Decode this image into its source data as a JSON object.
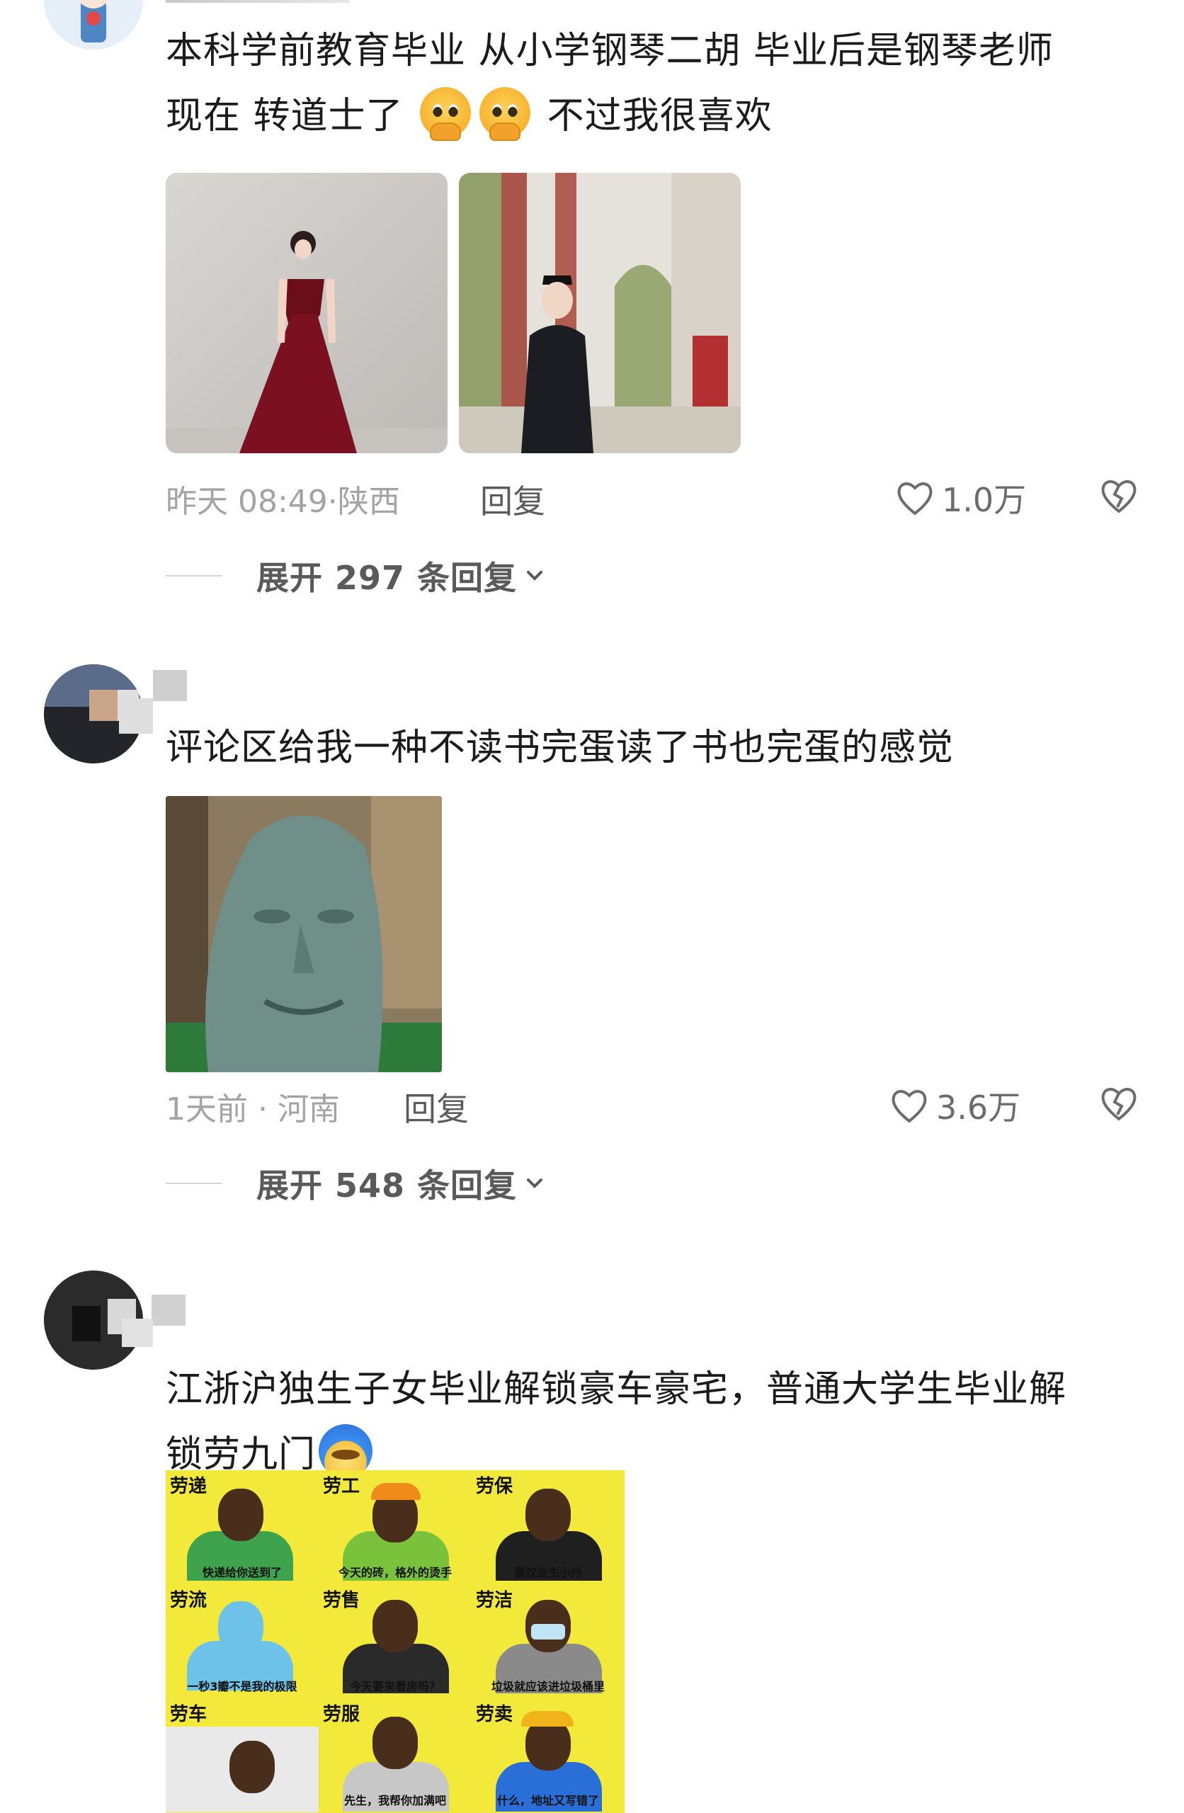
{
  "comments": [
    {
      "text_line1": "本科学前教育毕业 从小学钢琴二胡 毕业后是钢琴老师",
      "text_line2_prefix": "现在 转道士了",
      "text_line2_emoji": [
        "pleading-face-emoji",
        "pleading-face-emoji"
      ],
      "text_line2_suffix": "不过我很喜欢",
      "images": [
        "red-gown-photo",
        "taoist-robe-photo"
      ],
      "time": "昨天 08:49",
      "location": "陕西",
      "reply": "回复",
      "likes": "1.0万",
      "expand": "展开 297 条回复"
    },
    {
      "text_line1": "评论区给我一种不读书完蛋读了书也完蛋的感觉",
      "images": [
        "fish-face-meme"
      ],
      "time": "1天前",
      "location": "河南",
      "reply": "回复",
      "likes": "3.6万",
      "expand": "展开 548 条回复"
    },
    {
      "text_line1": "江浙沪独生子女毕业解锁豪车豪宅，普通大学生毕业解",
      "text_line2_prefix": "锁劳九门",
      "text_line2_emoji": [
        "blue-hair-face-emoji"
      ],
      "meme": {
        "cells": [
          {
            "title": "劳递",
            "caption": "快递给你送到了"
          },
          {
            "title": "劳工",
            "caption": "今天的砖，格外的烫手"
          },
          {
            "title": "劳保",
            "caption": "喜欢业主小丹"
          },
          {
            "title": "劳流",
            "caption": "一秒3瓣不是我的极限"
          },
          {
            "title": "劳售",
            "caption": "今天要来看房吗？"
          },
          {
            "title": "劳洁",
            "caption": "垃圾就应该进垃圾桶里"
          },
          {
            "title": "劳车",
            "caption": ""
          },
          {
            "title": "劳服",
            "caption": "先生，我帮你加满吧"
          },
          {
            "title": "劳卖",
            "caption": "什么，地址又写错了"
          }
        ]
      }
    }
  ],
  "colors": {
    "text": "#1b1b1b",
    "meta": "#a3a3a3",
    "reply": "#5b5b5b",
    "meme_bg": "#f3e93a"
  },
  "icons": [
    "heart-icon",
    "broken-heart-icon",
    "chevron-down-icon"
  ]
}
